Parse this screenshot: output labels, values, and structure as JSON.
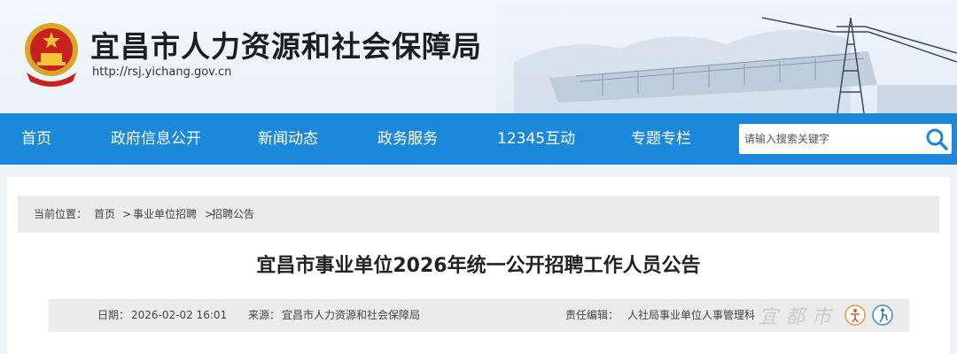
{
  "header": {
    "title": "宜昌市人力资源和社会保障局",
    "url": "http://rsj.yichang.gov.cn"
  },
  "nav": {
    "items": [
      {
        "label": "首页"
      },
      {
        "label": "政府信息公开"
      },
      {
        "label": "新闻动态"
      },
      {
        "label": "政务服务"
      },
      {
        "label": "12345互动"
      },
      {
        "label": "专题专栏"
      }
    ]
  },
  "search": {
    "placeholder": "请输入搜索关键字"
  },
  "breadcrumb": {
    "prefix": "当前位置：",
    "items": [
      "首页",
      "事业单位招聘",
      "招聘公告"
    ],
    "sep1": ">",
    "sep2": ">"
  },
  "article": {
    "title": "宜昌市事业单位2026年统一公开招聘工作人员公告",
    "date_label": "日期：",
    "date": "2026-02-02 16:01",
    "source_label": "来源：",
    "source": "宜昌市人力资源和社会保障局",
    "editor_label": "责任编辑：",
    "editor": "人社局事业单位人事管理科"
  },
  "watermark": "宜都市"
}
